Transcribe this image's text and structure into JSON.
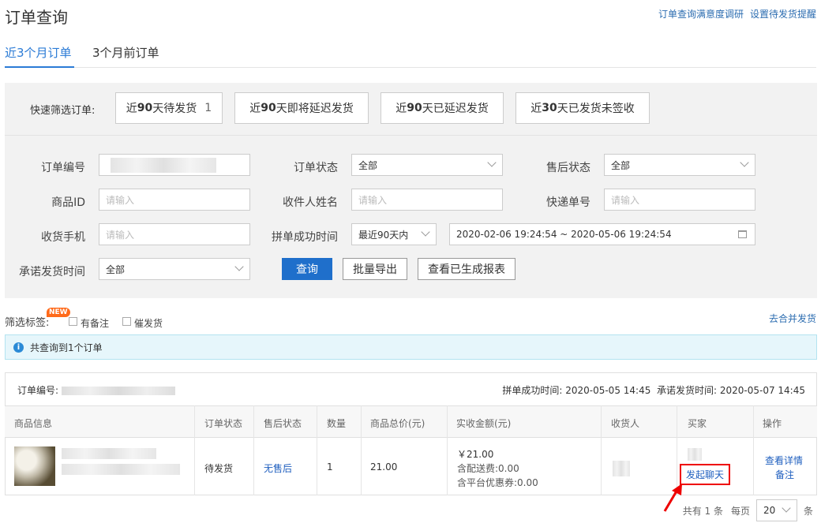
{
  "page": {
    "title": "订单查询"
  },
  "top_links": [
    "订单查询满意度调研",
    "设置待发货提醒"
  ],
  "tabs": [
    {
      "label": "近3个月订单",
      "active": true
    },
    {
      "label": "3个月前订单",
      "active": false
    }
  ],
  "quick_filter": {
    "label": "快速筛选订单:",
    "buttons": [
      {
        "prefix": "近",
        "num": "90",
        "suffix": "天待发货",
        "count": "1"
      },
      {
        "prefix": "近",
        "num": "90",
        "suffix": "天即将延迟发货",
        "count": ""
      },
      {
        "prefix": "近",
        "num": "90",
        "suffix": "天已延迟发货",
        "count": ""
      },
      {
        "prefix": "近",
        "num": "30",
        "suffix": "天已发货未签收",
        "count": ""
      }
    ]
  },
  "form": {
    "order_no_label": "订单编号",
    "order_status_label": "订单状态",
    "order_status_value": "全部",
    "after_sale_label": "售后状态",
    "after_sale_value": "全部",
    "product_id_label": "商品ID",
    "product_id_placeholder": "请输入",
    "receiver_label": "收件人姓名",
    "receiver_placeholder": "请输入",
    "express_label": "快递单号",
    "express_placeholder": "请输入",
    "phone_label": "收货手机",
    "phone_placeholder": "请输入",
    "group_time_label": "拼单成功时间",
    "group_time_value": "最近90天内",
    "date_range": "2020-02-06 19:24:54 ~ 2020-05-06 19:24:54",
    "promise_label": "承诺发货时间",
    "promise_value": "全部"
  },
  "actions": {
    "query": "查询",
    "export": "批量导出",
    "reports": "查看已生成报表"
  },
  "filter_tags": {
    "label": "筛选标签:",
    "badge": "NEW",
    "opt1": "有备注",
    "opt2": "催发货",
    "merge": "去合并发货"
  },
  "info": {
    "icon": "i",
    "text": "共查询到1个订单"
  },
  "order": {
    "no_label": "订单编号:",
    "group_time": "拼单成功时间: 2020-05-05 14:45",
    "promise_time": "承诺发货时间: 2020-05-07 14:45",
    "columns": [
      "商品信息",
      "订单状态",
      "售后状态",
      "数量",
      "商品总价(元)",
      "实收金额(元)",
      "收货人",
      "买家",
      "操作"
    ],
    "row": {
      "status": "待发货",
      "after_sale": "无售后",
      "qty": "1",
      "total": "21.00",
      "received": "￥21.00",
      "shipping": "含配送费:0.00",
      "discount": "含平台优惠券:0.00",
      "chat": "发起聊天",
      "detail": "查看详情",
      "note": "备注"
    }
  },
  "pager": {
    "total": "共有 1 条",
    "per_page": "每页",
    "size": "20",
    "unit": "条"
  }
}
